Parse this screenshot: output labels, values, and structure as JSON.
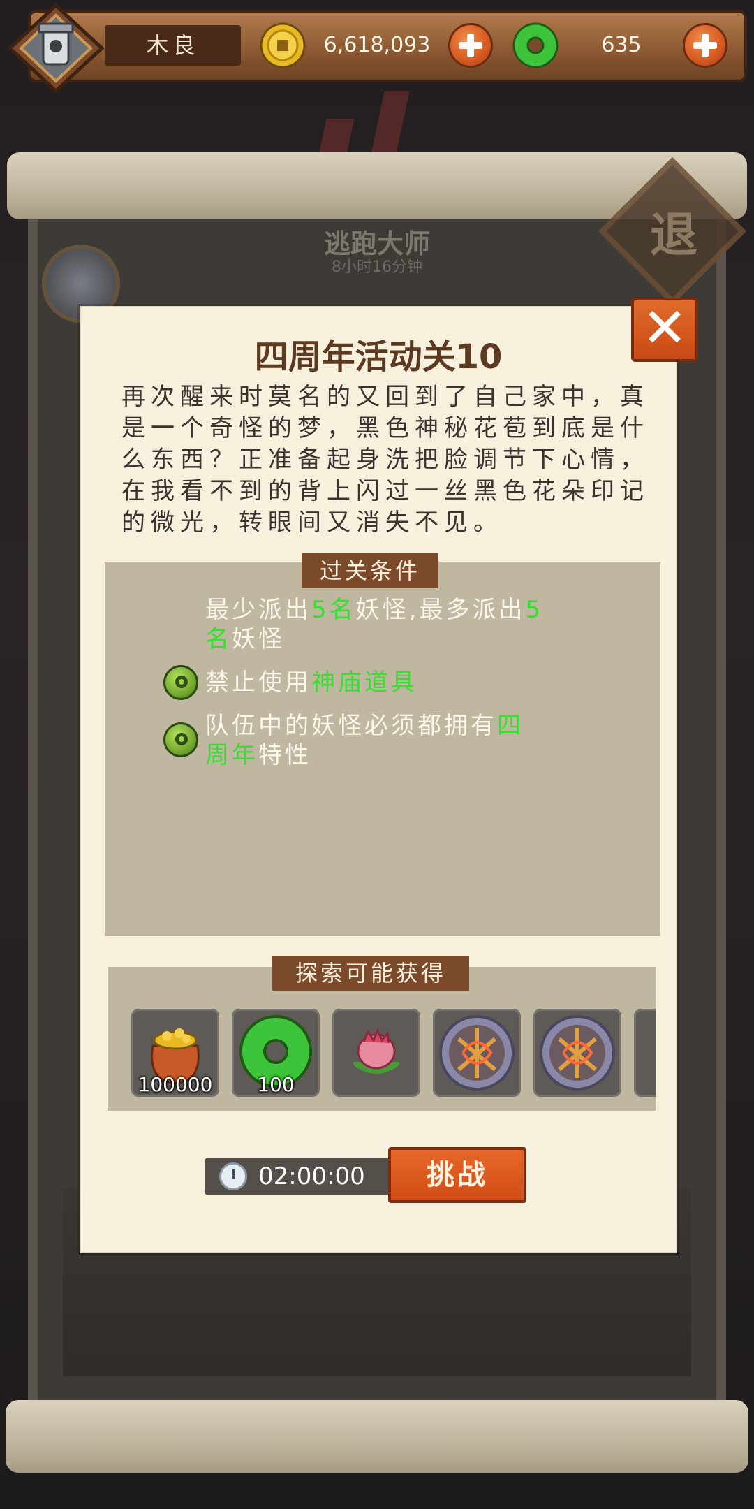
{
  "player": {
    "name": "木良"
  },
  "resources": {
    "coins": "6,618,093",
    "jade": "635"
  },
  "background": {
    "faded_title": "逃跑大师",
    "faded_timer": "8小时16分钟",
    "exit_label": "退"
  },
  "dialog": {
    "title": "四周年活动关10",
    "story": "再次醒来时莫名的又回到了自己家中，真是一个奇怪的梦，黑色神秘花苞到底是什么东西？正准备起身洗把脸调节下心情，在我看不到的背上闪过一丝黑色花朵印记的微光，转眼间又消失不见。",
    "close_symbol": "✕",
    "conditions_header": "过关条件",
    "conditions": [
      {
        "line1": [
          {
            "t": "最少派出",
            "hl": false
          },
          {
            "t": "5名",
            "hl": true
          },
          {
            "t": "妖怪,最多派出",
            "hl": false
          },
          {
            "t": "5",
            "hl": true
          }
        ],
        "line2": [
          {
            "t": "名",
            "hl": true
          },
          {
            "t": "妖怪",
            "hl": false
          }
        ],
        "has_icon": false
      },
      {
        "line1": [
          {
            "t": "禁止使用",
            "hl": false
          },
          {
            "t": "神庙道具",
            "hl": true
          }
        ],
        "has_icon": true
      },
      {
        "line1": [
          {
            "t": "队伍中的妖怪必须都拥有",
            "hl": false
          },
          {
            "t": "四",
            "hl": true
          }
        ],
        "line2": [
          {
            "t": "周年",
            "hl": true
          },
          {
            "t": "特性",
            "hl": false
          }
        ],
        "has_icon": true
      }
    ],
    "rewards_header": "探索可能获得",
    "rewards": [
      {
        "icon": "coin-bag-icon",
        "qty": "100000"
      },
      {
        "icon": "jade-ring-icon",
        "qty": "100"
      },
      {
        "icon": "flower-bud-icon",
        "qty": ""
      },
      {
        "icon": "orb-icon",
        "qty": ""
      },
      {
        "icon": "orb-icon",
        "qty": ""
      }
    ],
    "timer": "02:00:00",
    "challenge_label": "挑战"
  },
  "colors": {
    "highlight": "#35e030",
    "button_orange": "#d45a20",
    "parchment": "#f6f0dc"
  }
}
